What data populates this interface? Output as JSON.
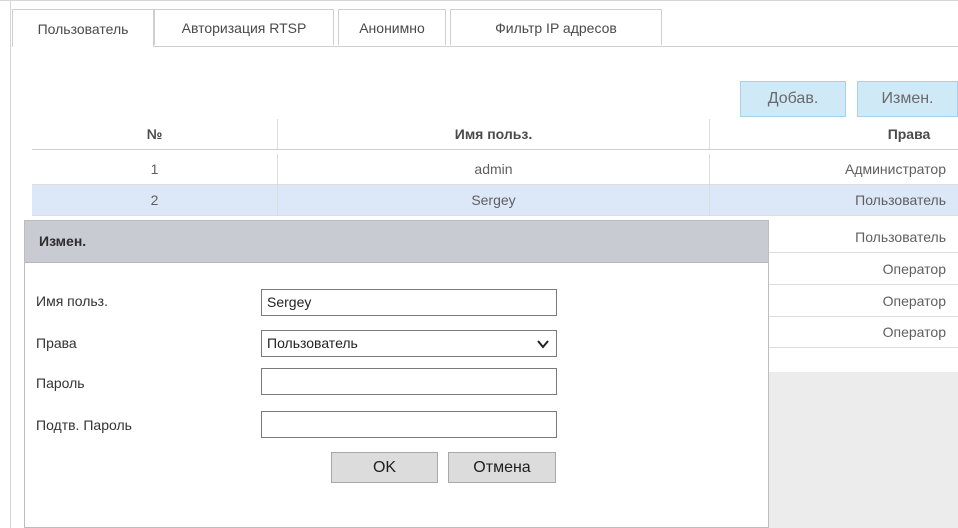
{
  "tabs": [
    {
      "label": "Пользователь",
      "active": true
    },
    {
      "label": "Авторизация RTSP",
      "active": false
    },
    {
      "label": "Анонимно",
      "active": false
    },
    {
      "label": "Фильтр IP адресов",
      "active": false
    }
  ],
  "actions": {
    "add_label": "Добав.",
    "edit_label": "Измен."
  },
  "table": {
    "headers": [
      "№",
      "Имя польз.",
      "Права"
    ],
    "rows": [
      [
        "1",
        "admin",
        "Администратор"
      ],
      [
        "2",
        "Sergey",
        "Пользователь"
      ],
      [
        "",
        "",
        "Пользователь"
      ],
      [
        "",
        "",
        "Оператор"
      ],
      [
        "",
        "",
        "Оператор"
      ],
      [
        "",
        "",
        "Оператор"
      ]
    ],
    "selected_row": 2
  },
  "dialog": {
    "title": "Измен.",
    "fields": {
      "username_label": "Имя польз.",
      "username_value": "Sergey",
      "rights_label": "Права",
      "rights_value": "Пользователь",
      "password_label": "Пароль",
      "password_value": "",
      "confirm_label": "Подтв. Пароль",
      "confirm_value": ""
    },
    "ok_label": "OK",
    "cancel_label": "Отмена"
  },
  "colors": {
    "action_button_bg": "#cfe9f7",
    "selected_row_bg": "#dce8f7",
    "dialog_header_bg": "#c8ccd2"
  }
}
